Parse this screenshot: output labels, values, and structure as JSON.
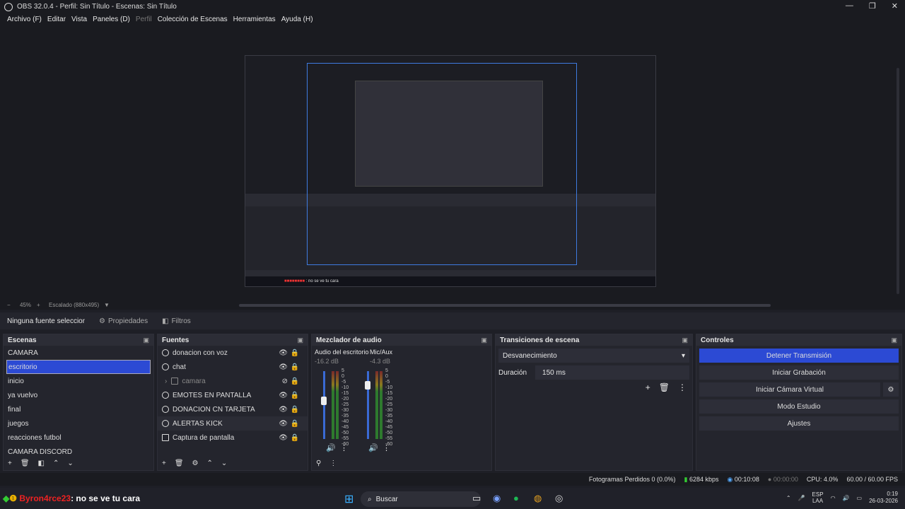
{
  "window": {
    "title": "OBS 32.0.4 - Perfil: Sin Título - Escenas: Sin Título"
  },
  "menu": {
    "items": [
      "Archivo (F)",
      "Editar",
      "Vista",
      "Paneles (D)",
      "Perfil",
      "Colección de Escenas",
      "Herramientas",
      "Ayuda (H)"
    ]
  },
  "preview": {
    "zoom": "45%",
    "scale_label": "Escalado (880x495)"
  },
  "source_toolbar": {
    "no_source": "Ninguna fuente seleccionada",
    "properties": "Propiedades",
    "filters": "Filtros"
  },
  "scenes": {
    "title": "Escenas",
    "items": [
      "CAMARA",
      "escritorio",
      "inicio",
      "ya vuelvo",
      "final",
      "juegos",
      "reacciones futbol",
      "CAMARA DISCORD"
    ],
    "selected": 1
  },
  "sources": {
    "title": "Fuentes",
    "items": [
      "donacion con voz",
      "chat",
      "camara",
      "EMOTES EN PANTALLA",
      "DONACION CN TARJETA",
      "ALERTAS KICK",
      "Captura de pantalla"
    ]
  },
  "mixer": {
    "title": "Mezclador de audio",
    "channels": [
      {
        "name": "Audio del escritorio",
        "db": "-16.2 dB"
      },
      {
        "name": "Mic/Aux",
        "db": "-4.3 dB"
      }
    ],
    "scale": [
      "5",
      "0",
      "-5",
      "-10",
      "-15",
      "-20",
      "-25",
      "-30",
      "-35",
      "-40",
      "-45",
      "-50",
      "-55",
      "-60"
    ]
  },
  "transitions": {
    "title": "Transiciones de escena",
    "selected": "Desvanecimiento",
    "duration_label": "Duración",
    "duration_value": "150 ms"
  },
  "controls": {
    "title": "Controles",
    "buttons": [
      "Detener Transmisión",
      "Iniciar Grabación",
      "Iniciar Cámara Virtual",
      "Modo Estudio",
      "Ajustes"
    ]
  },
  "status": {
    "dropped": "Fotogramas Perdidos 0 (0.0%)",
    "bitrate": "6284 kbps",
    "stream_time": "00:10:08",
    "rec_time": "00:00:00",
    "cpu": "CPU: 4.0%",
    "fps": "60.00 / 60.00 FPS"
  },
  "taskbar": {
    "chat_user": "Byron4rce23",
    "chat_msg": ": no se ve tu cara",
    "search": "Buscar",
    "lang": "ESP",
    "lang2": "LAA",
    "time": "0:19",
    "date": "26-03-2026"
  },
  "colors": {
    "accent": "#2c4ad4",
    "bg": "#1e1f26",
    "panel": "#24252d"
  }
}
